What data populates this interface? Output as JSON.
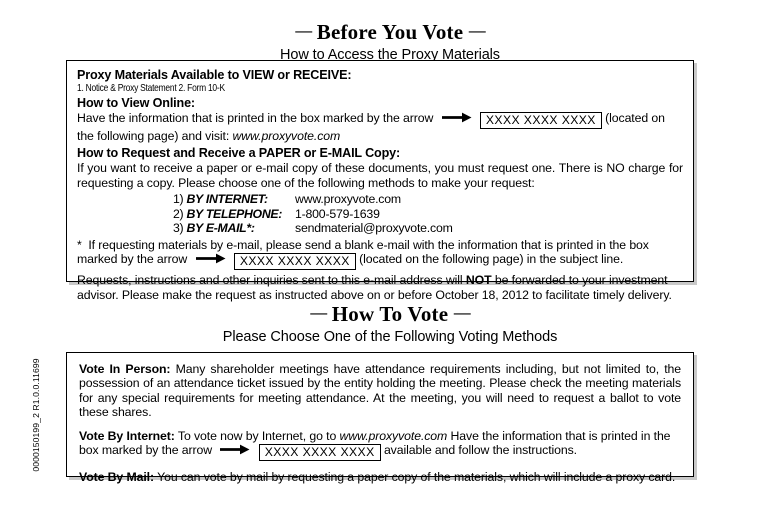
{
  "margin_id": "0000150199_2   R1.0.0.11699",
  "section1": {
    "title": "Before You Vote",
    "rule": "—",
    "subtitle": "How to Access the Proxy Materials",
    "avail_heading": "Proxy Materials Available to VIEW or RECEIVE:",
    "avail_items": "1. Notice & Proxy Statement      2. Form 10-K",
    "view_heading": "How to View Online:",
    "view_text_a": "Have the information that is printed in the box marked by the arrow",
    "view_code": "XXXX XXXX XXXX",
    "view_text_b": "(located on the following page) and visit:",
    "view_url": "www.proxyvote.com",
    "request_heading": "How to Request and Receive a PAPER or E-MAIL Copy:",
    "request_text": "If you want to receive a paper or e-mail copy of these documents, you must request one.  There is NO charge for requesting a copy.  Please choose one of the following methods to make your request:",
    "methods": [
      {
        "num": "1)",
        "label": "BY INTERNET:",
        "value": "www.proxyvote.com"
      },
      {
        "num": "2)",
        "label": "BY TELEPHONE:",
        "value": "1-800-579-1639"
      },
      {
        "num": "3)",
        "label": "BY E-MAIL*:",
        "value": "sendmaterial@proxyvote.com"
      }
    ],
    "footnote_marker": "*",
    "footnote_a": "If requesting materials by e-mail, please send a blank e-mail with the information that is printed in the box marked by the arrow",
    "footnote_code": "XXXX XXXX XXXX",
    "footnote_b": "(located on the following page) in the subject line.",
    "closing_a": "Requests, instructions and other inquiries sent to this e-mail address will",
    "closing_not": "NOT",
    "closing_b": "be forwarded to your investment advisor. Please make the request as instructed above on or before October 18, 2012 to facilitate timely delivery."
  },
  "section2": {
    "title": "How To Vote",
    "rule": "—",
    "subtitle": "Please Choose One of the Following Voting Methods",
    "in_person_label": "Vote In Person:",
    "in_person_text": "Many shareholder meetings have attendance requirements including, but not limited to, the possession of an attendance ticket issued by the entity holding the meeting. Please check the meeting materials for any special requirements for meeting attendance.  At the meeting, you will need to request a ballot to vote these shares.",
    "internet_label": "Vote By Internet:",
    "internet_text_a": "To vote now by Internet, go to",
    "internet_url": "www.proxyvote.com",
    "internet_text_b": "Have the information that is printed in the box marked by the arrow",
    "internet_code": "XXXX XXXX XXXX",
    "internet_text_c": "available and follow the instructions.",
    "mail_label": "Vote By Mail:",
    "mail_text": "You can vote by mail by requesting a paper copy of the materials, which will include a proxy card."
  }
}
